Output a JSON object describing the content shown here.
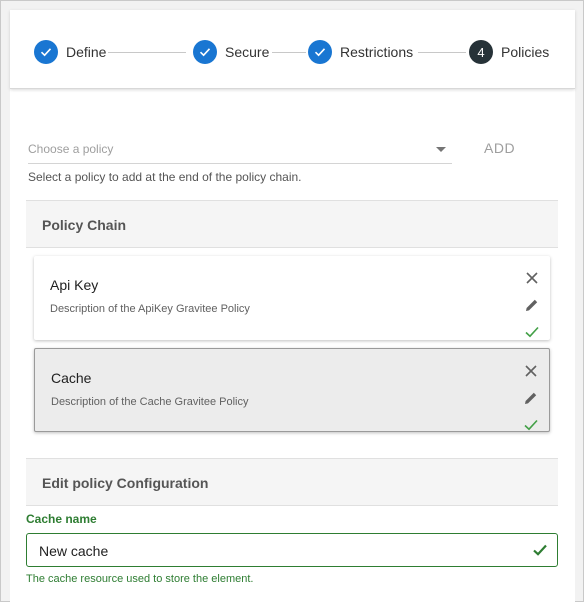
{
  "stepper": {
    "steps": [
      {
        "label": "Define",
        "state": "done"
      },
      {
        "label": "Secure",
        "state": "done"
      },
      {
        "label": "Restrictions",
        "state": "done"
      },
      {
        "label": "Policies",
        "state": "active",
        "number": "4"
      }
    ]
  },
  "policy_select": {
    "placeholder": "Choose a policy",
    "add_label": "ADD",
    "hint": "Select a policy to add at the end of the policy chain."
  },
  "policy_chain": {
    "title": "Policy Chain",
    "policies": [
      {
        "name": "Api Key",
        "description": "Description of the ApiKey Gravitee Policy",
        "selected": false
      },
      {
        "name": "Cache",
        "description": "Description of the Cache Gravitee Policy",
        "selected": true
      }
    ]
  },
  "edit_config": {
    "title": "Edit policy Configuration",
    "field_label": "Cache name",
    "field_value": "New cache",
    "field_hint": "The cache resource used to store the element."
  },
  "colors": {
    "step_done": "#1976d2",
    "step_active": "#263238",
    "valid": "#2e7d32"
  }
}
